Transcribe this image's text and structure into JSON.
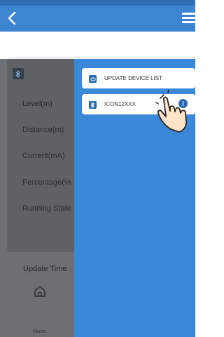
{
  "header": {
    "back_icon": "chevron-left-icon",
    "menu_icon": "hamburger-menu-icon"
  },
  "background": {
    "labels": [
      "Level(m)",
      "Distance(m)",
      "Current(mA)",
      "Percentage(%",
      "Running State"
    ],
    "update_time_label": "Update Time",
    "home_label": "Home"
  },
  "drawer": {
    "update_button": "UPDATE DEVICE LIST",
    "device_name": "ICON12XXX"
  },
  "colors": {
    "appbar": "#3d86cf",
    "drawer": "#3b88d8",
    "accent": "#2a6ab0"
  }
}
